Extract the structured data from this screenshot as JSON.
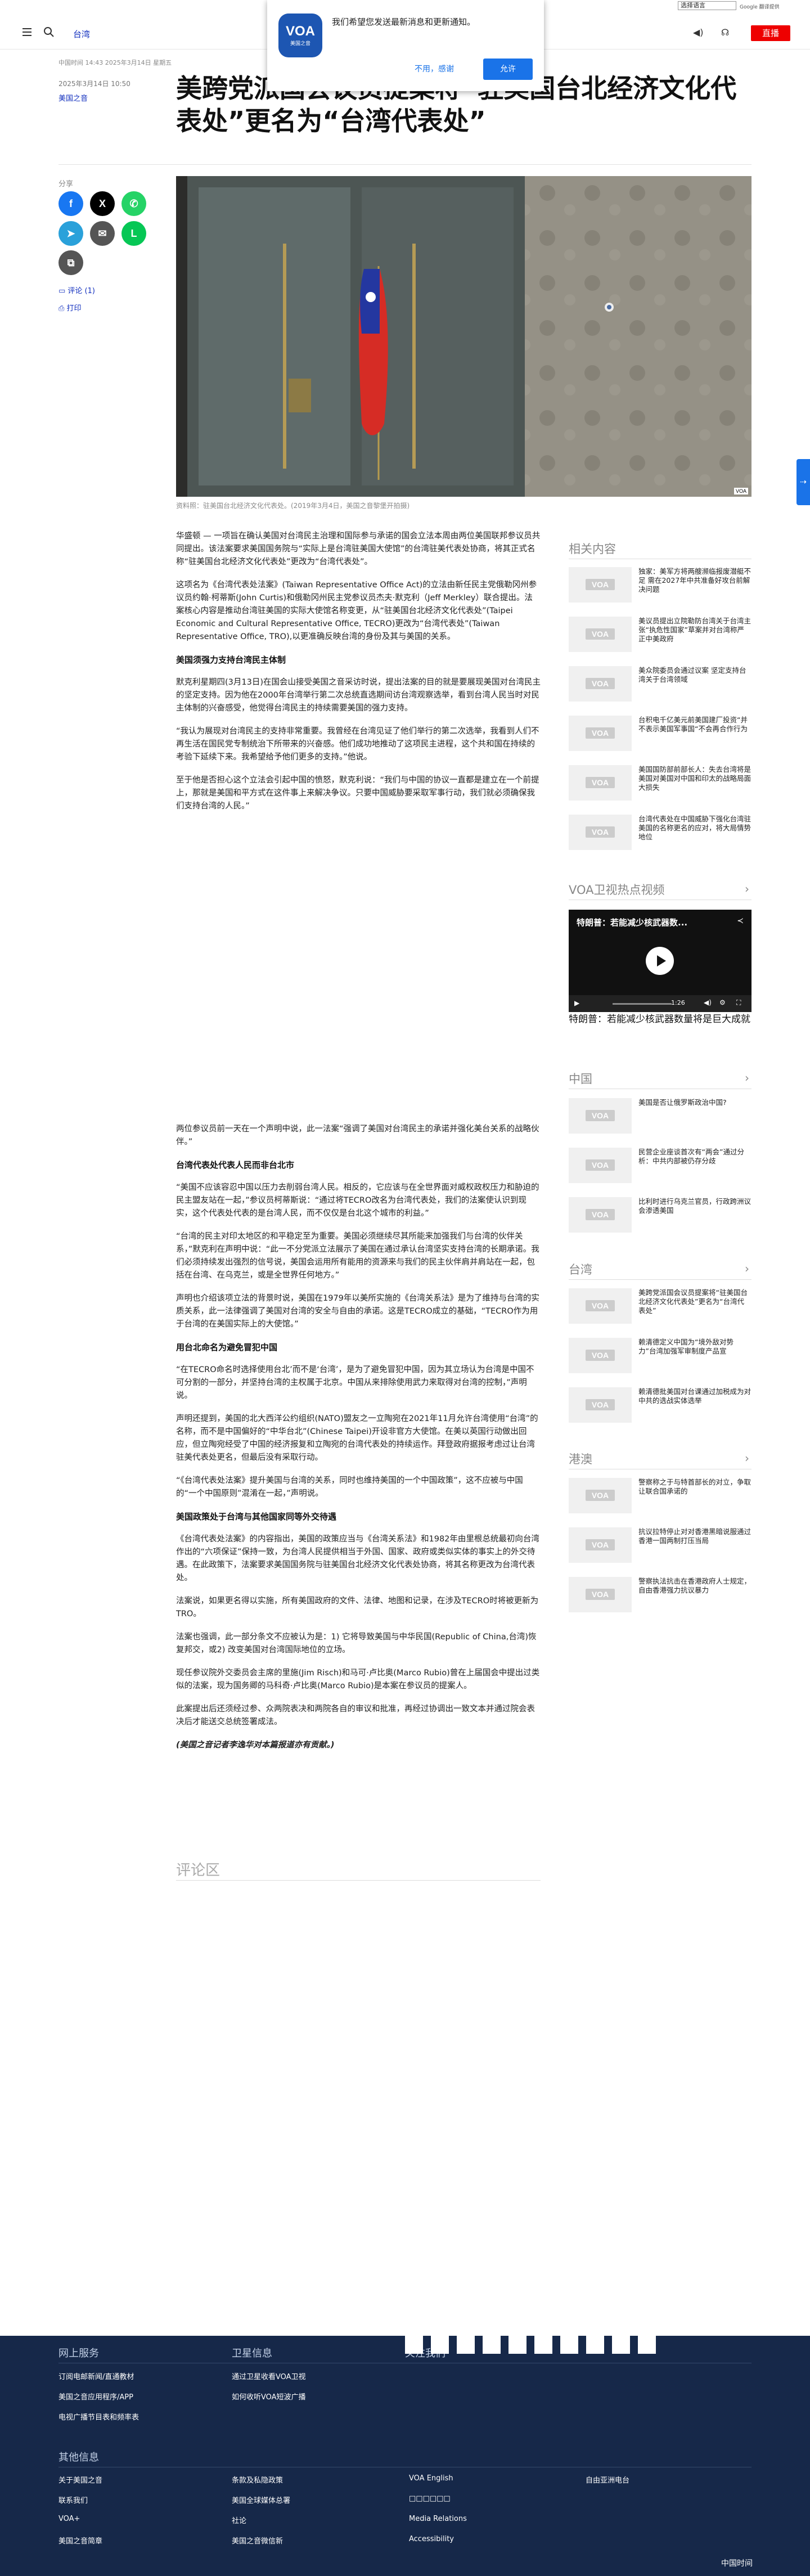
{
  "utility": {
    "language_select": "选择语言",
    "google_translate": "Google 翻译提供"
  },
  "header": {
    "section": "台湾",
    "live_label": "直播"
  },
  "notification": {
    "logo_main": "VOA",
    "logo_sub": "美国之音",
    "message": "我们希望您发送最新消息和更新通知。",
    "deny_label": "不用，感谢",
    "allow_label": "允许"
  },
  "article": {
    "dates": "中国时间 14:43 2025年3月14日 星期五",
    "published": "2025年3月14日 10:50",
    "author": "美国之音",
    "title": "美跨党派国会议员提案将“驻美国台北经济文化代表处”更名为“台湾代表处”",
    "image_caption": "资料照：驻美国台北经济文化代表处。(2019年3月4日，美国之音黎堡开拍摄)",
    "image_badge": "VOA",
    "paragraphs": [
      "华盛顿 — 一项旨在确认美国对台湾民主治理和国际参与承诺的国会立法本周由两位美国联邦参议员共同提出。该法案要求美国国务院与“实际上是台湾驻美国大使馆”的台湾驻美代表处协商，将其正式名称“驻美国台北经济文化代表处”更改为“台湾代表处”。",
      "这项名为《台湾代表处法案》(Taiwan Representative Office Act)的立法由新任民主党俄勒冈州参议员约翰·柯蒂斯(John Curtis)和俄勒冈州民主党参议员杰夫·默克利（Jeff Merkley）联合提出。法案核心内容是推动台湾驻美国的实际大使馆名称变更，从“驻美国台北经济文化代表处”(Taipei Economic and Cultural Representative Office, TECRO)更改为“台湾代表处”(Taiwan Representative Office, TRO),以更准确反映台湾的身份及其与美国的关系。",
      "默克利星期四(3月13日)在国会山接受美国之音采访时说，提出法案的目的就是要展现美国对台湾民主的坚定支持。因为他在2000年台湾举行第二次总统直选期间访台湾观察选举，看到台湾人民当时对民主体制的兴奋感受，他觉得台湾民主的持续需要美国的强力支持。",
      "“我认为展现对台湾民主的支持非常重要。我曾经在台湾见证了他们举行的第二次选举，我看到人们不再生活在国民党专制统治下所带来的兴奋感。他们成功地推动了这项民主进程，这个共和国在持续的考验下延续下来。我希望给予他们更多的支持。”他说。",
      "至于他是否担心这个立法会引起中国的愤怒，默克利说：“我们与中国的协议一直都是建立在一个前提上，那就是美国和平方式在这件事上来解决争议。只要中国威胁要采取军事行动，我们就必须确保我们支持台湾的人民。”",
      "两位参议员前一天在一个声明中说，此一法案“强调了美国对台湾民主的承诺并强化美台关系的战略伙伴。”",
      "“美国不应该容忍中国以压力去削弱台湾人民。相反的，它应该与在全世界面对威权政权压力和胁迫的民主盟友站在一起，”参议员柯蒂斯说：“通过将TECRO改名为台湾代表处，我们的法案使认识到现实，这个代表处代表的是台湾人民，而不仅仅是台北这个城市的利益。”",
      "“台湾的民主对印太地区的和平稳定至为重要。美国必须继续尽其所能来加强我们与台湾的伙伴关系，”默克利在声明中说：“此一不分党派立法展示了美国在通过承认台湾坚实支持台湾的长期承诺。我们必须持续发出强烈的信号说，美国会运用所有能用的资源来与我们的民主伙伴肩并肩站在一起，包括在台湾、在乌克兰，或是全世界任何地方。”",
      "声明也介绍该项立法的背景时说，美国在1979年以美所实施的《台湾关系法》是为了维持与台湾的实质关系，此一法律强调了美国对台湾的安全与自由的承诺。这是TECRO成立的基础，“TECRO作为用于台湾的在美国实际上的大使馆。”",
      "“在TECRO命名时选择使用台北’而不是‘台湾’，是为了避免冒犯中国，因为其立场认为台湾是中国不可分割的一部分，并坚持台湾的主权属于北京。中国从来排除使用武力来取得对台湾的控制，”声明说。",
      "声明还提到，美国的北大西洋公约组织(NATO)盟友之一立陶宛在2021年11月允许台湾使用“台湾”的名称，而不是中国偏好的“中华台北”(Chinese Taipei)开设非官方大使馆。在美以英国行动做出回应，但立陶宛经受了中国的经济报复和立陶宛的台湾代表处的持续运作。拜登政府据报考虑过让台湾驻美代表处更名，但最后没有采取行动。",
      "“《台湾代表处法案》提升美国与台湾的关系，同时也维持美国的一个中国政策”，这不应被与中国的“一个中国原则”混淆在一起，”声明说。",
      "《台湾代表处法案》的内容指出，美国的政策应当与《台湾关系法》和1982年由里根总统最初向台湾作出的“六项保证”保持一致，为台湾人民提供相当于外国、国家、政府或类似实体的事实上的外交待遇。在此政策下，法案要求美国国务院与驻美国台北经济文化代表处协商，将其名称更改为台湾代表处。",
      "法案说，如果更名得以实施，所有美国政府的文件、法律、地图和记录，在涉及TECRO时将被更新为TRO。",
      "法案也强调，此一部分条文不应被认为是：1) 它将导致美国与中华民国(Republic of China,台湾)恢复邦交，或2) 改变美国对台湾国际地位的立场。",
      "现任参议院外交委员会主席的里施(Jim Risch)和马可·卢比奥(Marco Rubio)曾在上届国会中提出过类似的法案，现为国务卿的马科奇·卢比奥(Marco Rubio)是本案在参议员的提案人。",
      "此案提出后还须经过参、众两院表决和两院各自的审议和批准，再经过协调出一致文本并通过院会表决后才能送交总统签署成法。",
      "(美国之音记者李逸华对本篇报道亦有贡献。)"
    ],
    "headings": [
      "美国须强力支持台湾民主体制",
      "台湾代表处代表人民而非台北市",
      "用台北命名为避免冒犯中国",
      "美国政策处于台湾与其他国家同等外交待遇"
    ],
    "comments_title": "评论区"
  },
  "share": {
    "label": "分享",
    "comments_link": "评论 (1)",
    "print_link": "打印"
  },
  "rail": {
    "related_title": "相关内容",
    "related": [
      "独家：美军方将两艘濒临报废潜艇不足 需在2027年中共准备好攻台前解决问题",
      "美议员提出立院勒防台湾关于台湾主张“执危性国家”草案并对台湾称严正中美政府",
      "美众院委员会通过议案 坚定支持台湾关于台湾领域",
      "台积电千亿美元前美国建厂投资“并不表示美国军事国“不会再合作行为",
      "美国国防部前部长人：失去台湾将是美国对美国对中国和印太的战略局面大损失",
      "台湾代表处在中国威胁下强化台湾驻美国的名称更名的应对，将大局情势地位"
    ],
    "video_title": "VOA卫视热点视频",
    "video_overlay_title": "特朗普：若能减少核武器数...",
    "video_time": "1:26",
    "video_caption": "特朗普：若能减少核武器数量将是巨大成就",
    "china_title": "中国",
    "china": [
      "美国是否让俄罗斯政治中国?",
      "民营企业座谈首次有“两会”通过分析：中共内部被仍存分歧",
      "比利时进行乌克兰官员，行政跨洲议会渗透美国"
    ],
    "taiwan_title": "台湾",
    "taiwan": [
      "美跨党派国会议员提案将“驻美国台北经济文化代表处”更名为“台湾代表处”",
      "赖清德定义中国为“境外敌对势力”台湾加强军审制度产品宣",
      "赖清德批美国对台课通过加税成为对中共的选战实体选举"
    ],
    "hk_title": "港澳",
    "hk": [
      "警察称之于与特首部长的对立，争取让联合国承诺的",
      "抗议拉特停止对对香港黑暗说服通过香港一国两制打压当局",
      "警察执法抗击在香港政府人士规定，自由香港强力抗议暴力"
    ],
    "thumb_badge": "VOA"
  },
  "footer": {
    "online_title": "网上服务",
    "online_links": [
      "订阅电邮新闻/直通教材",
      "美国之音应用程序/APP",
      "电视广播节目表和频率表"
    ],
    "satellite_title": "卫星信息",
    "satellite_links": [
      "通过卫星收看VOA卫视",
      "如何收听VOA短波广播"
    ],
    "follow_title": "关注我们",
    "social": [
      "f",
      "X",
      "▶",
      "in",
      "✆",
      "◎",
      "▣",
      "☞",
      "◉",
      "✉"
    ],
    "other_title": "其他信息",
    "other_col1": [
      "关于美国之音",
      "联系我们",
      "VOA+",
      "美国之音简章"
    ],
    "other_col2": [
      "条款及私隐政策",
      "美国全球媒体总署",
      "社论",
      "美国之音微信新"
    ],
    "other_col3": [
      "VOA English",
      "□□□□□□",
      "Media Relations",
      "Accessibility"
    ],
    "other_col4": [
      "自由亚洲电台"
    ],
    "copyright": "中国时间"
  }
}
